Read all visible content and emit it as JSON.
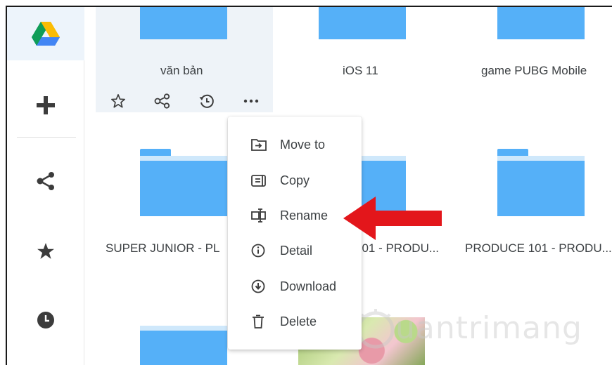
{
  "folders": {
    "top": [
      "văn bản",
      "iOS 11",
      "game PUBG Mobile"
    ],
    "middle": [
      "SUPER JUNIOR - PL",
      "101 - PRODU...",
      "PRODUCE 101 - PRODU..."
    ]
  },
  "selected_folder_actions": [
    {
      "icon": "star-icon"
    },
    {
      "icon": "share-icon"
    },
    {
      "icon": "history-icon"
    },
    {
      "icon": "more-icon"
    }
  ],
  "context_menu": {
    "items": [
      {
        "label": "Move to",
        "icon": "move-to-icon"
      },
      {
        "label": "Copy",
        "icon": "copy-icon"
      },
      {
        "label": "Rename",
        "icon": "rename-icon"
      },
      {
        "label": "Detail",
        "icon": "info-icon"
      },
      {
        "label": "Download",
        "icon": "download-icon"
      },
      {
        "label": "Delete",
        "icon": "trash-icon"
      }
    ]
  },
  "sidebar": {
    "items": [
      {
        "icon": "drive-logo-icon"
      },
      {
        "icon": "plus-icon"
      },
      {
        "icon": "share-icon"
      },
      {
        "icon": "star-icon"
      },
      {
        "icon": "clock-icon"
      }
    ]
  },
  "watermark": {
    "text": "uantrimang"
  },
  "colors": {
    "folder": "#55b0f8",
    "selected": "#eef3f8",
    "arrow": "#e3161b"
  }
}
